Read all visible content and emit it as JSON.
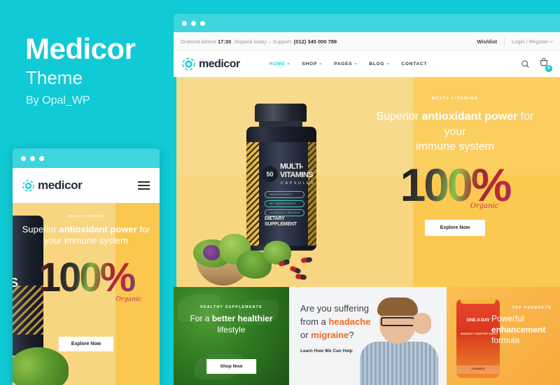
{
  "promo": {
    "title": "Medicor",
    "subtitle": "Theme",
    "author": "By Opal_WP",
    "accent_color": "#10cad5"
  },
  "mobile_preview": {
    "logo_text": "medicor",
    "menu_icon": "hamburger-icon",
    "hero": {
      "eyebrow": "MULTI-VITAMINS",
      "headline_pre": "Superior ",
      "headline_strong": "antioxidant power",
      "headline_post": " for your immune system",
      "big_number": "100%",
      "organic_label": "Organic",
      "cta": "Explore Now"
    },
    "bottle_word": "NS"
  },
  "browser": {
    "topbar": {
      "notice_pre": "Ordered before ",
      "notice_time": "17:30",
      "notice_mid": ", shipped today – Support: ",
      "notice_phone": "(012) 345 000 789",
      "wishlist": "Wishlist",
      "account": "Login / Register"
    },
    "nav": {
      "logo_text": "medicor",
      "items": [
        {
          "label": "HOME",
          "has_dropdown": true,
          "active": true
        },
        {
          "label": "SHOP",
          "has_dropdown": true,
          "active": false
        },
        {
          "label": "PAGES",
          "has_dropdown": true,
          "active": false
        },
        {
          "label": "BLOG",
          "has_dropdown": true,
          "active": false
        },
        {
          "label": "CONTACT",
          "has_dropdown": false,
          "active": false
        }
      ],
      "search_icon": "search-icon",
      "cart_icon": "cart-icon",
      "cart_count": "0"
    },
    "hero": {
      "eyebrow": "MULTI-VITAMINS",
      "headline_pre": "Superior ",
      "headline_strong": "antioxidant power",
      "headline_post": " for your",
      "headline_line2": "immune system",
      "big_number": "100%",
      "organic_label": "Organic",
      "cta": "Explore Now",
      "bottle": {
        "badge": "50",
        "title_l1": "MULTI-",
        "title_l2": "VITAMINS",
        "subtitle": "CAPSULES",
        "claims": [
          "HIGH POTENCY",
          "50+ INGREDIENTS",
          "CLINICALLY PROVEN"
        ],
        "footer_l1": "DIETARY",
        "footer_l2": "SUPPLEMENT"
      }
    },
    "cards": [
      {
        "eyebrow": "HEALTHY SUPPLEMENTS",
        "headline_pre": "For a ",
        "headline_strong": "better healthier",
        "headline_post": " lifestyle",
        "cta": "Shop Now"
      },
      {
        "line1": "Are you suffering",
        "line2_pre": "from a ",
        "line2_strong": "headache",
        "line3_pre": "or ",
        "line3_strong": "migraine",
        "line3_post": "?",
        "link": "Learn How We Can Help"
      },
      {
        "eyebrow": "TOP PRODUCTS",
        "headline_pre": "Powerful ",
        "headline_strong": "enhancement",
        "headline_post": " formula",
        "jar_brand": "ONE A DAY",
        "jar_sub": "IMMUNITY SUPPORT MULTI",
        "jar_band": "GUMMIES"
      }
    ]
  }
}
